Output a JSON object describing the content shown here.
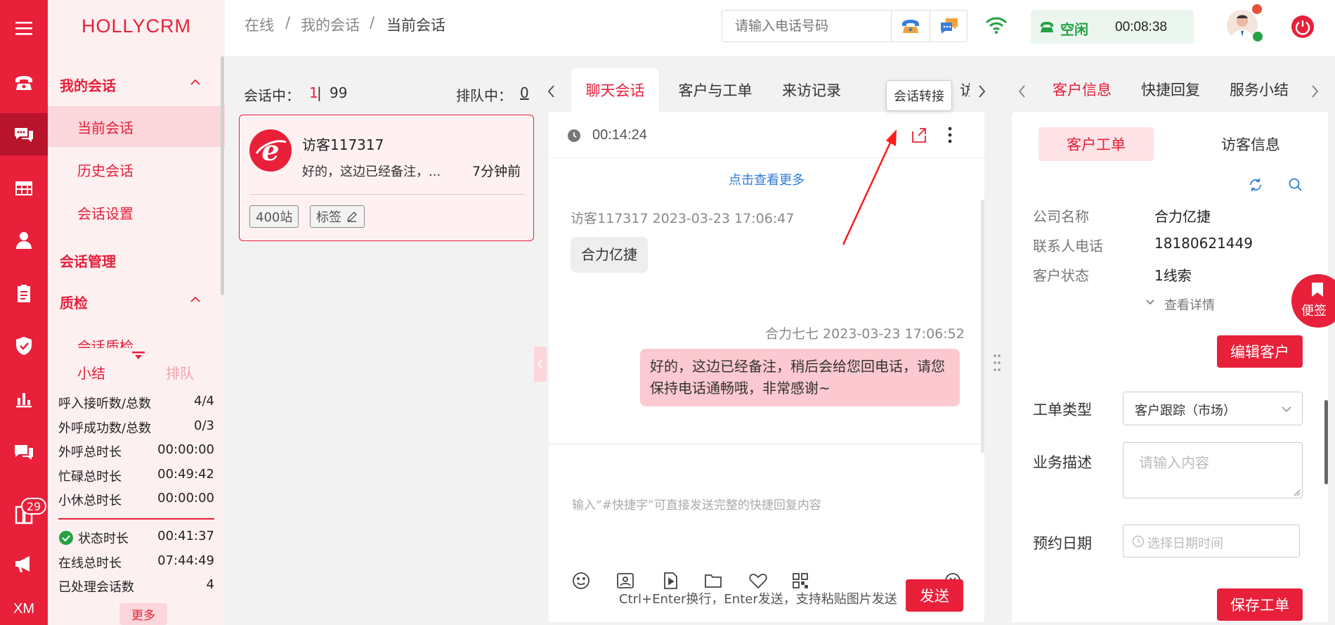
{
  "app": {
    "brand": "HOLLYCRM",
    "badge_count": "29",
    "rail_bottom": "XM"
  },
  "nav": {
    "my_sessions": "我的会话",
    "current_session": "当前会话",
    "history_session": "历史会话",
    "session_settings": "会话设置",
    "session_management": "会话管理",
    "quality": "质检",
    "session_quality": "会话质检"
  },
  "stats": {
    "tab_summary": "小结",
    "tab_queue": "排队",
    "rows": [
      {
        "label": "呼入接听数/总数",
        "value": "4/4"
      },
      {
        "label": "外呼成功数/总数",
        "value": "0/3"
      },
      {
        "label": "外呼总时长",
        "value": "00:00:00"
      },
      {
        "label": "忙碌总时长",
        "value": "00:49:42"
      },
      {
        "label": "小休总时长",
        "value": "00:00:00"
      }
    ],
    "rows2": [
      {
        "label": "状态时长",
        "value": "00:41:37"
      },
      {
        "label": "在线总时长",
        "value": "07:44:49"
      },
      {
        "label": "已处理会话数",
        "value": "4"
      }
    ],
    "more": "更多"
  },
  "topbar": {
    "crumb1": "在线",
    "crumb2": "我的会话",
    "crumb3": "当前会话",
    "sep": "/",
    "phone_placeholder": "请输入电话号码",
    "status": "空闲",
    "timer": "00:08:38"
  },
  "sessions": {
    "in_session_label": "会话中：",
    "in_session_count": "1",
    "in_session_sep": " | ",
    "in_session_total": "99",
    "queue_label": "排队中：",
    "queue_count": "0",
    "card": {
      "name": "访客117317",
      "preview": "好的，这边已经备注，...",
      "time": "7分钟前",
      "tag1": "400站",
      "tag2": "标签"
    }
  },
  "chat": {
    "tabs": [
      "聊天会话",
      "客户与工单",
      "来访记录",
      "访"
    ],
    "timer": "00:14:24",
    "tooltip": "会话转接",
    "load_more": "点击查看更多",
    "msg1_meta": "访客117317 2023-03-23 17:06:47",
    "msg1_text": "合力亿捷",
    "msg2_meta": "合力七七 2023-03-23 17:06:52",
    "msg2_text": "好的，这边已经备注，稍后会给您回电话，请您保持电话通畅哦，非常感谢~",
    "input_placeholder": "输入“#快捷字”可直接发送完整的快捷回复内容",
    "hint": "Ctrl+Enter换行，Enter发送，支持粘贴图片发送",
    "send": "发送"
  },
  "right": {
    "tabs": [
      "客户信息",
      "快捷回复",
      "服务小结"
    ],
    "subtab1": "客户工单",
    "subtab2": "访客信息",
    "fields": [
      {
        "label": "公司名称",
        "value": "合力亿捷"
      },
      {
        "label": "联系人电话",
        "value": "18180621449"
      },
      {
        "label": "客户状态",
        "value": "1线索"
      }
    ],
    "view_detail": "查看详情",
    "edit_customer": "编辑客户",
    "order_type_label": "工单类型",
    "order_type_value": "客户跟踪（市场）",
    "desc_label": "业务描述",
    "desc_placeholder": "请输入内容",
    "date_label": "预约日期",
    "date_placeholder": "选择日期时间",
    "save_order": "保存工单",
    "sticky": "便签"
  }
}
